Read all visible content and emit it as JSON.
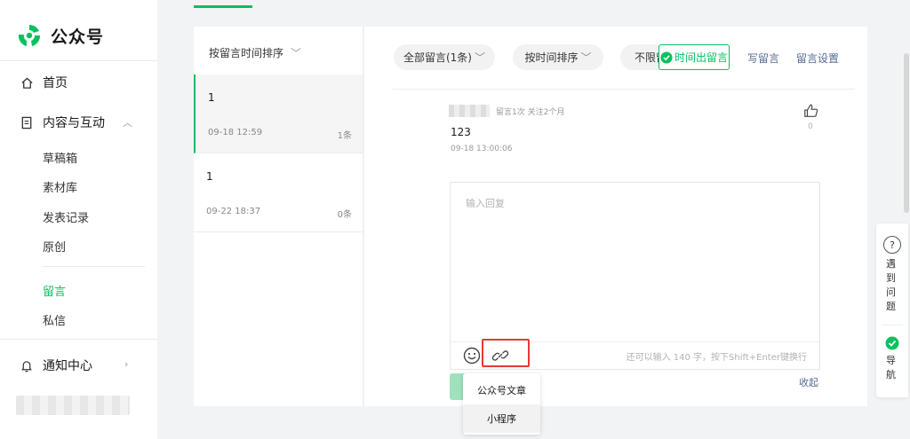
{
  "app": {
    "name": "公众号",
    "brand_color": "#07c160"
  },
  "sidebar": {
    "home": "首页",
    "content": "内容与互动",
    "sub_items": [
      "草稿箱",
      "素材库",
      "发表记录",
      "原创"
    ],
    "comment": "留言",
    "message": "私信",
    "notify": "通知中心"
  },
  "left_list": {
    "sort_label": "按留言时间排序",
    "items": [
      {
        "title": "1",
        "time": "09-18 12:59",
        "count": "1条"
      },
      {
        "title": "1",
        "time": "09-22 18:37",
        "count": "0条"
      }
    ]
  },
  "toolbar": {
    "filter_all": "全部留言(1条)",
    "sort_time": "按时间排序",
    "unlimited": "不限留",
    "overlay_btn": "时间出留言",
    "write": "写留言",
    "settings": "留言设置"
  },
  "comment": {
    "meta": "留言1次 关注2个月",
    "text": "123",
    "time": "09-18 13:00:06",
    "likes": "0"
  },
  "reply": {
    "placeholder": "输入回复",
    "hint": "还可以输入 140 字，按下Shift+Enter键换行",
    "collapse": "收起"
  },
  "dropdown": {
    "items": [
      "公众号文章",
      "小程序"
    ]
  },
  "float": {
    "help": "遇到问题",
    "nav": "导航"
  }
}
